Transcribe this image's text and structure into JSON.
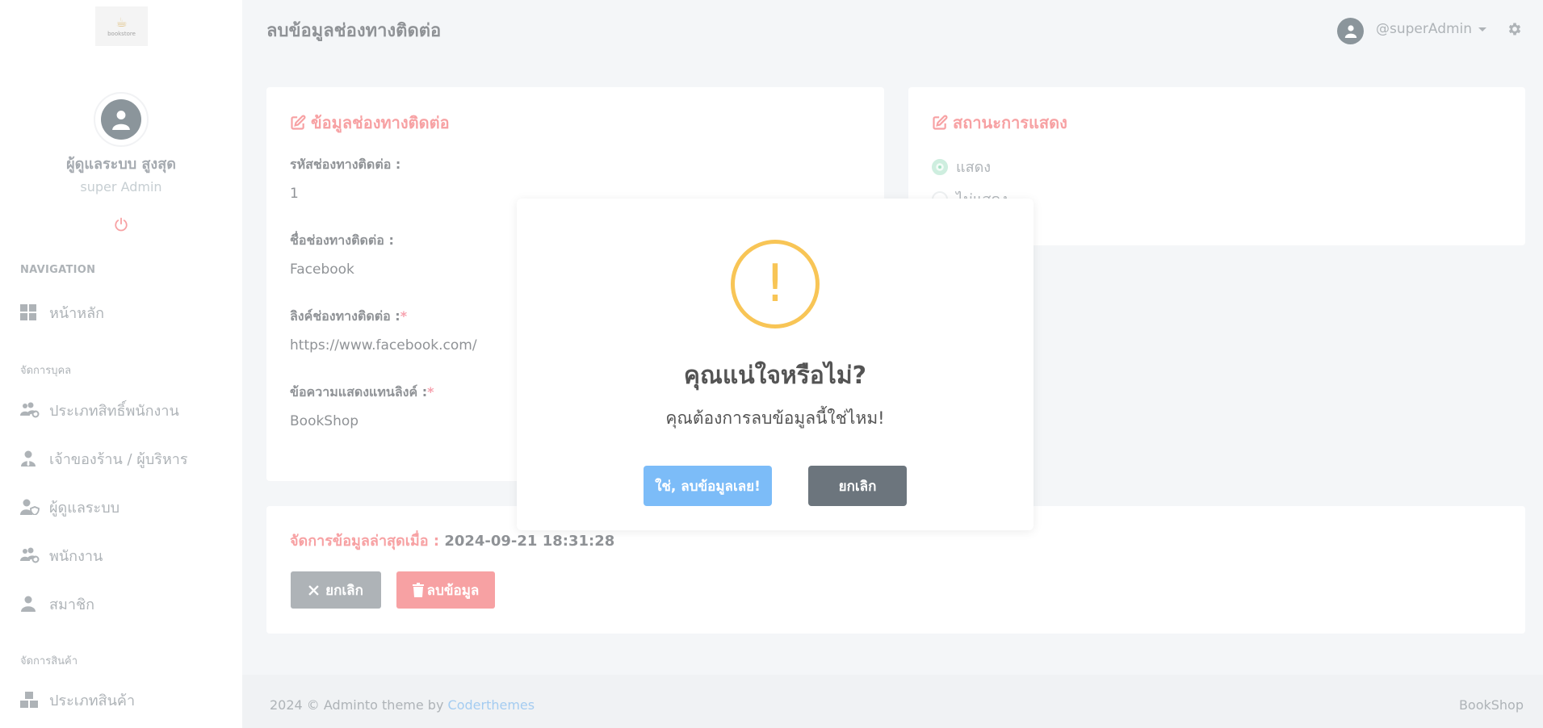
{
  "sidebar": {
    "logo_text": "bookstore",
    "user_name": "ผู้ดูแลระบบ สูงสุด",
    "user_role": "super Admin",
    "nav_title": "NAVIGATION",
    "home": "หน้าหลัก",
    "section_people": "จัดการบุคล",
    "people_items": [
      "ประเภทสิทธิ์พนักงาน",
      "เจ้าของร้าน / ผู้บริหาร",
      "ผู้ดูแลระบบ",
      "พนักงาน",
      "สมาชิก"
    ],
    "section_products": "จัดการสินค้า",
    "product_items": [
      "ประเภทสินค้า"
    ]
  },
  "topbar": {
    "page_title": "ลบข้อมูลช่องทางติดต่อ",
    "username": "@superAdmin"
  },
  "info_card": {
    "title": "ข้อมูลช่องทางติดต่อ",
    "fields": [
      {
        "label": "รหัสช่องทางติดต่อ :",
        "required": "",
        "value": "1"
      },
      {
        "label": "ชื่อช่องทางติดต่อ :",
        "required": "",
        "value": "Facebook"
      },
      {
        "label": "ลิงค์ช่องทางติดต่อ :",
        "required": "*",
        "value": "https://www.facebook.com/"
      },
      {
        "label": "ข้อความแสดงแทนลิงค์ :",
        "required": "*",
        "value": "BookShop"
      }
    ]
  },
  "status_card": {
    "title": "สถานะการแสดง",
    "options": [
      "แสดง",
      "ไม่แสดง"
    ],
    "selected": "แสดง"
  },
  "action_card": {
    "updated_label": "จัดการข้อมูลล่าสุดเมื่อ :",
    "updated_value": "2024-09-21 18:31:28",
    "cancel_label": "ยกเลิก",
    "delete_label": "ลบข้อมูล"
  },
  "footer": {
    "left_text": "2024 © Adminto theme by",
    "link_text": "Coderthemes",
    "right_text": "BookShop"
  },
  "modal": {
    "icon": "!",
    "title": "คุณแน่ใจหรือไม่?",
    "text": "คุณต้องการลบข้อมูลนี้ใช่ไหม!",
    "confirm_label": "ใช่, ลบข้อมูลเลย!",
    "cancel_label": "ยกเลิก"
  },
  "colors": {
    "accent_red": "#f15458",
    "warning": "#f8c556",
    "confirm": "#7cbcf8",
    "grey": "#6c757d",
    "success": "#5fcd97"
  }
}
